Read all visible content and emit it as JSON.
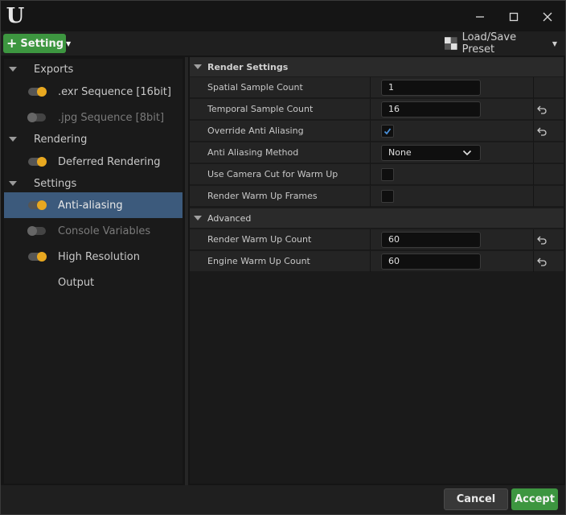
{
  "titlebar": {
    "logo_text": "U",
    "icons": [
      "unreal-logo-icon",
      "minimize-icon",
      "maximize-icon",
      "close-icon"
    ]
  },
  "toolbar": {
    "add_label": "Setting",
    "preset_label": "Load/Save Preset"
  },
  "sidebar": {
    "groups": [
      {
        "label": "Exports"
      },
      {
        "label": "Rendering"
      },
      {
        "label": "Settings"
      }
    ],
    "items": [
      {
        "label": ".exr Sequence [16bit]",
        "enabled": true
      },
      {
        "label": ".jpg Sequence [8bit]",
        "enabled": false
      },
      {
        "label": "Deferred Rendering",
        "enabled": true
      },
      {
        "label": "Anti-aliasing",
        "enabled": true,
        "selected": true
      },
      {
        "label": "Console Variables",
        "enabled": false
      },
      {
        "label": "High Resolution",
        "enabled": true
      },
      {
        "label": "Output"
      }
    ]
  },
  "details": {
    "section_render": "Render Settings",
    "section_advanced": "Advanced",
    "props": [
      {
        "name": "Spatial Sample Count",
        "value": "1"
      },
      {
        "name": "Temporal Sample Count",
        "value": "16"
      },
      {
        "name": "Override Anti Aliasing",
        "checked": true
      },
      {
        "name": "Anti Aliasing Method",
        "value": "None"
      },
      {
        "name": "Use Camera Cut for Warm Up",
        "checked": false
      },
      {
        "name": "Render Warm Up Frames",
        "checked": false
      },
      {
        "name": "Render Warm Up Count",
        "value": "60"
      },
      {
        "name": "Engine Warm Up Count",
        "value": "60"
      }
    ]
  },
  "footer": {
    "cancel_label": "Cancel",
    "accept_label": "Accept"
  },
  "colors": {
    "accent_green": "#3d9640",
    "selection_blue": "#3c5a7c",
    "toggle_on": "#e8a820",
    "checkmark": "#4a90d9"
  }
}
